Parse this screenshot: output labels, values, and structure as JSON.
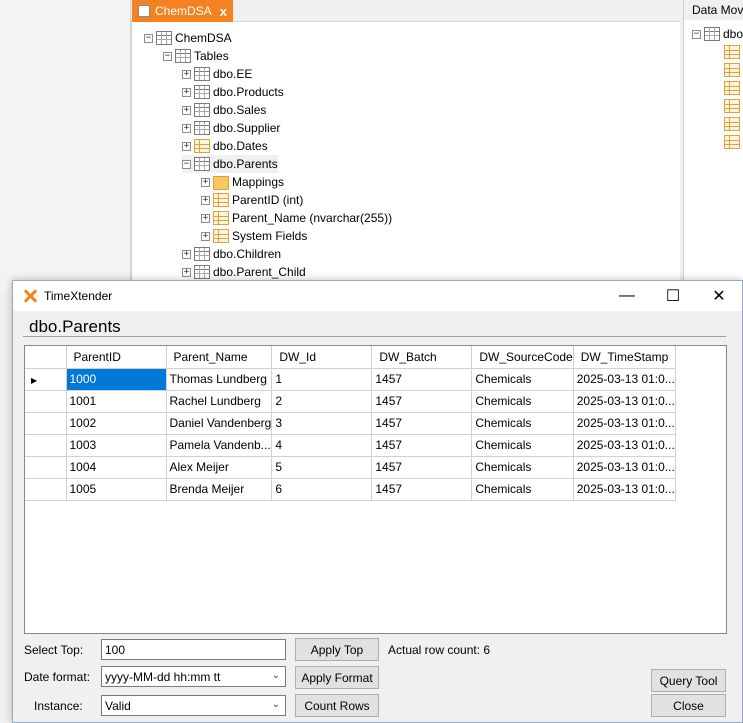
{
  "app": {
    "tab_title": "ChemDSA",
    "tab_close": "x",
    "right_panel_title": "Data Movement",
    "right_tree_root": "dbo"
  },
  "tree": {
    "root": "ChemDSA",
    "tables_label": "Tables",
    "items": [
      {
        "label": "dbo.EE"
      },
      {
        "label": "dbo.Products"
      },
      {
        "label": "dbo.Sales"
      },
      {
        "label": "dbo.Supplier"
      },
      {
        "label": "dbo.Dates"
      },
      {
        "label": "dbo.Parents"
      },
      {
        "label": "Mappings"
      },
      {
        "label": "ParentID (int)"
      },
      {
        "label": "Parent_Name (nvarchar(255))"
      },
      {
        "label": "System Fields"
      },
      {
        "label": "dbo.Children"
      },
      {
        "label": "dbo.Parent_Child"
      }
    ]
  },
  "dialog": {
    "title": "TimeXtender",
    "table_name": "dbo.Parents",
    "minimize": "—",
    "maximize": "☐",
    "close": "✕"
  },
  "grid": {
    "columns": [
      "ParentID",
      "Parent_Name",
      "DW_Id",
      "DW_Batch",
      "DW_SourceCode",
      "DW_TimeStamp"
    ],
    "rows": [
      [
        "1000",
        "Thomas Lundberg",
        "1",
        "1457",
        "Chemicals",
        "2025-03-13 01:0..."
      ],
      [
        "1001",
        "Rachel Lundberg",
        "2",
        "1457",
        "Chemicals",
        "2025-03-13 01:0..."
      ],
      [
        "1002",
        "Daniel Vandenberg",
        "3",
        "1457",
        "Chemicals",
        "2025-03-13 01:0..."
      ],
      [
        "1003",
        "Pamela Vandenb...",
        "4",
        "1457",
        "Chemicals",
        "2025-03-13 01:0..."
      ],
      [
        "1004",
        "Alex Meijer",
        "5",
        "1457",
        "Chemicals",
        "2025-03-13 01:0..."
      ],
      [
        "1005",
        "Brenda Meijer",
        "6",
        "1457",
        "Chemicals",
        "2025-03-13 01:0..."
      ]
    ]
  },
  "controls": {
    "select_top_label": "Select Top:",
    "select_top_value": "100",
    "apply_top": "Apply Top",
    "row_count": "Actual row count: 6",
    "date_format_label": "Date format:",
    "date_format_value": "yyyy-MM-dd hh:mm tt",
    "apply_format": "Apply Format",
    "instance_label": "Instance:",
    "instance_value": "Valid",
    "count_rows": "Count Rows",
    "query_tool": "Query Tool",
    "close": "Close"
  },
  "colors": {
    "accent": "#f58220",
    "selection": "#0078d7"
  }
}
